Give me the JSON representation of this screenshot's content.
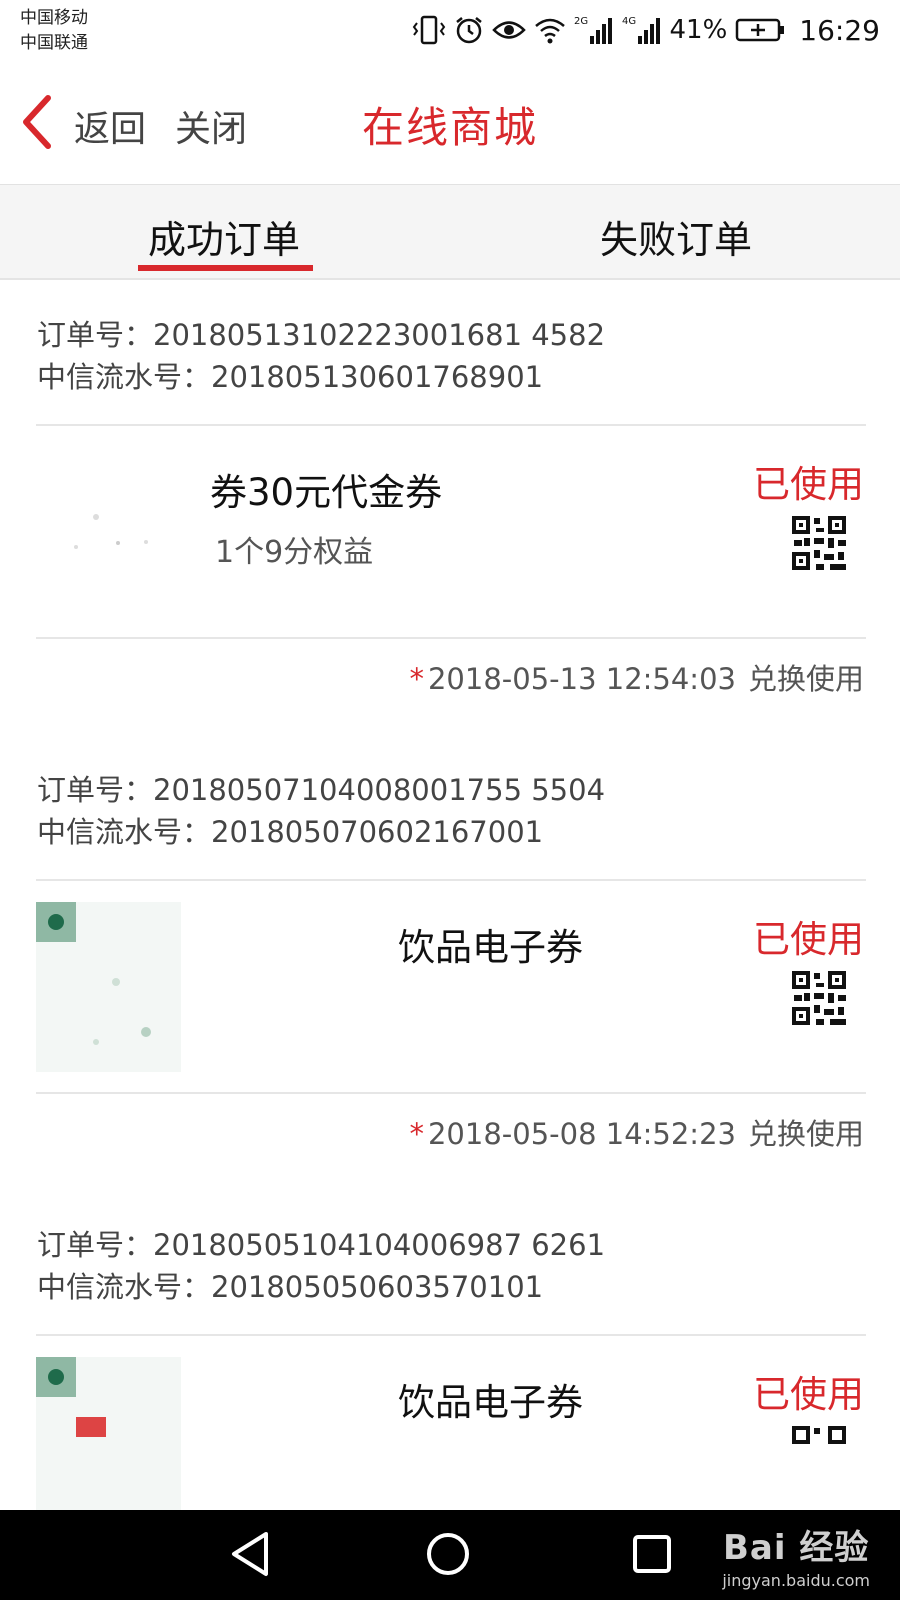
{
  "status_bar": {
    "carrier1": "中国移动",
    "carrier2": "中国联通",
    "net_2g": "2G",
    "net_4g": "4G",
    "battery_pct": "41%",
    "time": "16:29"
  },
  "nav": {
    "back_label": "返回",
    "close_label": "关闭",
    "title": "在线商城"
  },
  "tabs": {
    "success": "成功订单",
    "failed": "失败订单",
    "active": "success"
  },
  "orders": [
    {
      "order_no": "订单号：20180513102223001681 4582",
      "serial_no": "中信流水号：201805130601768901",
      "item_name": "券30元代金券",
      "item_sub": "1个9分权益",
      "status": "已使用",
      "datetime": "2018-05-13 12:54:03",
      "action": "兑换使用"
    },
    {
      "order_no": "订单号：20180507104008001755 5504",
      "serial_no": "中信流水号：201805070602167001",
      "item_name": "饮品电子券",
      "item_sub": "",
      "status": "已使用",
      "datetime": "2018-05-08 14:52:23",
      "action": "兑换使用"
    },
    {
      "order_no": "订单号：20180505104104006987 6261",
      "serial_no": "中信流水号：201805050603570101",
      "item_name": "饮品电子券",
      "item_sub": "",
      "status": "已使用",
      "datetime": "",
      "action": ""
    }
  ],
  "footer_star": "*",
  "watermark": {
    "main": "Bai 经验",
    "sub": "jingyan.baidu.com"
  },
  "colors": {
    "accent": "#d8282c",
    "background": "#ffffff",
    "section_gap": "#f0f0f0"
  }
}
